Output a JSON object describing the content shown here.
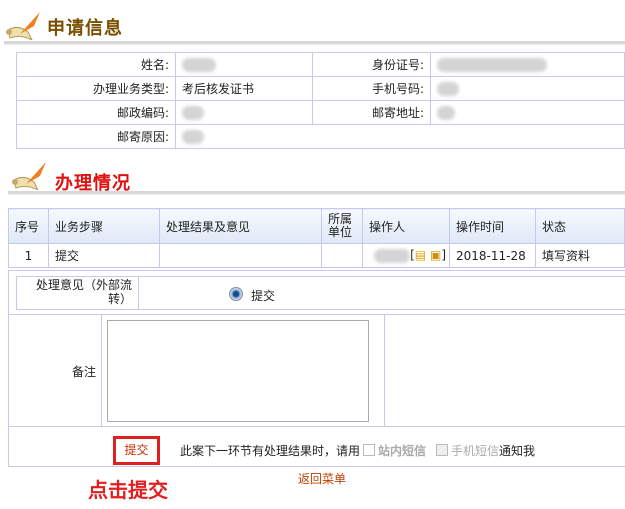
{
  "section1": {
    "title": "申请信息",
    "color": "#7a4e00"
  },
  "info": {
    "name_label": "姓名:",
    "id_label": "身份证号:",
    "type_label": "办理业务类型:",
    "type_value": "考后核发证书",
    "phone_label": "手机号码:",
    "zip_label": "邮政编码:",
    "addr_label": "邮寄地址:",
    "reason_label": "邮寄原因:"
  },
  "section2": {
    "title": "办理情况",
    "color": "#e01010"
  },
  "process": {
    "headers": [
      "序号",
      "业务步骤",
      "处理结果及意见",
      "所属单位",
      "操作人",
      "操作时间",
      "状态"
    ],
    "rows": [
      {
        "no": "1",
        "step": "提交",
        "result": "",
        "unit": "",
        "time": "2018-11-28",
        "status": "填写资料"
      }
    ]
  },
  "form": {
    "opinion_label": "处理意见（外部流转）",
    "radio_label": "提交",
    "remark_label": "备注",
    "remark_value": "",
    "submit_label": "提交",
    "notify_prefix": "此案下一环节有处理结果时，请用",
    "notify_site": "站内短信",
    "notify_sms": "手机短信",
    "notify_suffix": "通知我"
  },
  "back_link": "返回菜单",
  "annotation": "点击提交"
}
